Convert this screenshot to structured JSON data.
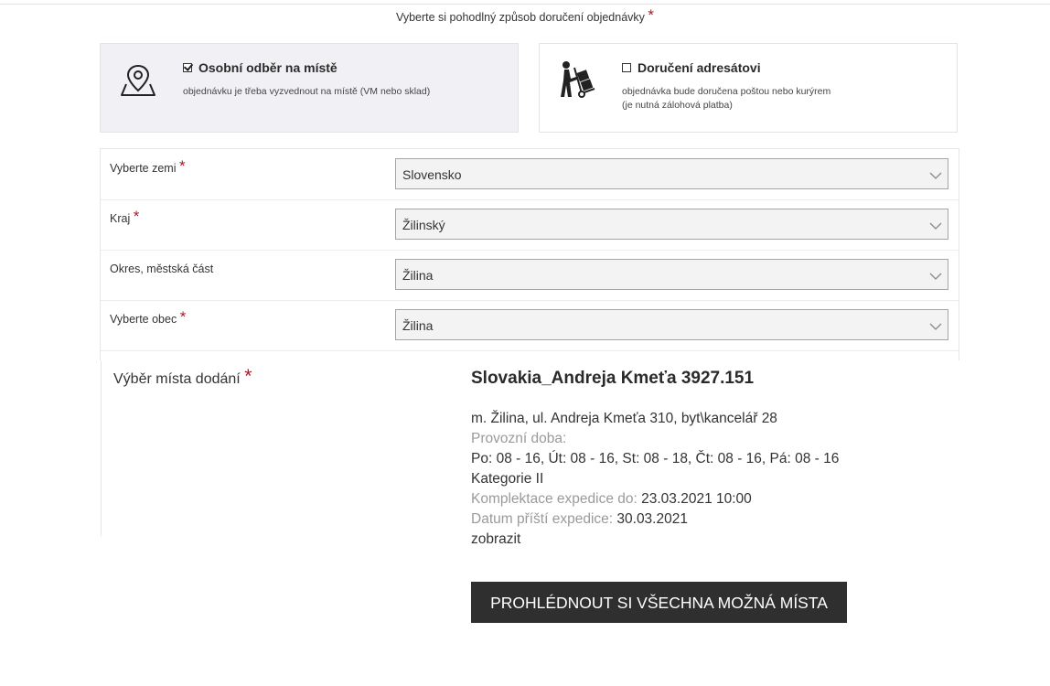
{
  "heading": "Vyberte si pohodlný způsob doručení objednávky",
  "required_mark": "*",
  "options": {
    "pickup": {
      "title": "Osobní odběr na místě",
      "description": "objednávku je třeba vyzvednout na místě (VM nebo sklad)",
      "checked": true,
      "icon": "map-pin-icon"
    },
    "delivery": {
      "title": "Doručení adresátovi",
      "description_line1": "objednávka bude doručena poštou nebo kurýrem",
      "description_line2": "(je nutná zálohová platba)",
      "checked": false,
      "icon": "hand-truck-icon"
    }
  },
  "form": {
    "country_label": "Vyberte zemi",
    "country_value": "Slovensko",
    "region_label": "Kraj",
    "region_value": "Žilinský",
    "district_label": "Okres, městská část",
    "district_value": "Žilina",
    "municipality_label": "Vyberte obec",
    "municipality_value": "Žilina"
  },
  "place": {
    "label": "Výběr místa dodání",
    "title": "Slovakia_Andreja Kmeťa 3927.151",
    "address": "m. Žilina, ul. Andreja Kmeťa 310, byt\\kancelář 28",
    "hours_label": "Provozní doba:",
    "hours": "Po: 08 - 16, Út: 08 - 16, St: 08 - 18, Čt: 08 - 16, Pá: 08 - 16",
    "category": "Kategorie II",
    "completion_label": "Komplektace expedice do:",
    "completion_value": "23.03.2021 10:00",
    "next_label": "Datum příští expedice:",
    "next_value": "30.03.2021",
    "show_link": "zobrazit",
    "button_label": "PROHLÉDNOUT SI VŠECHNA MOŽNÁ MÍSTA"
  },
  "colors": {
    "required": "#a8192e",
    "button_bg": "#2f2f2f",
    "selected_card_bg": "#f1f1f5"
  }
}
